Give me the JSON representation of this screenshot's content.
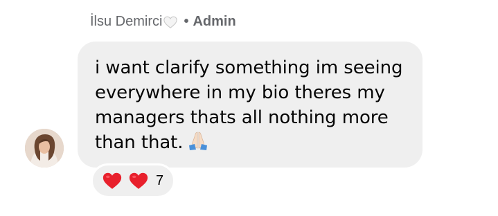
{
  "comment": {
    "author": "İlsu Demirci",
    "separator": "•",
    "role": "Admin",
    "message": "i want clarify something im seeing everywhere in my bio theres my managers thats all nothing more than that.",
    "author_badge_icon": "white-heart-icon",
    "message_emoji_icon": "folded-hands-icon"
  },
  "reactions": {
    "icons": [
      "red-heart-icon",
      "red-heart-icon"
    ],
    "count": "7"
  },
  "colors": {
    "bubble": "#efefef",
    "meta_text": "#65676b",
    "heart_red": "#e8202c"
  }
}
